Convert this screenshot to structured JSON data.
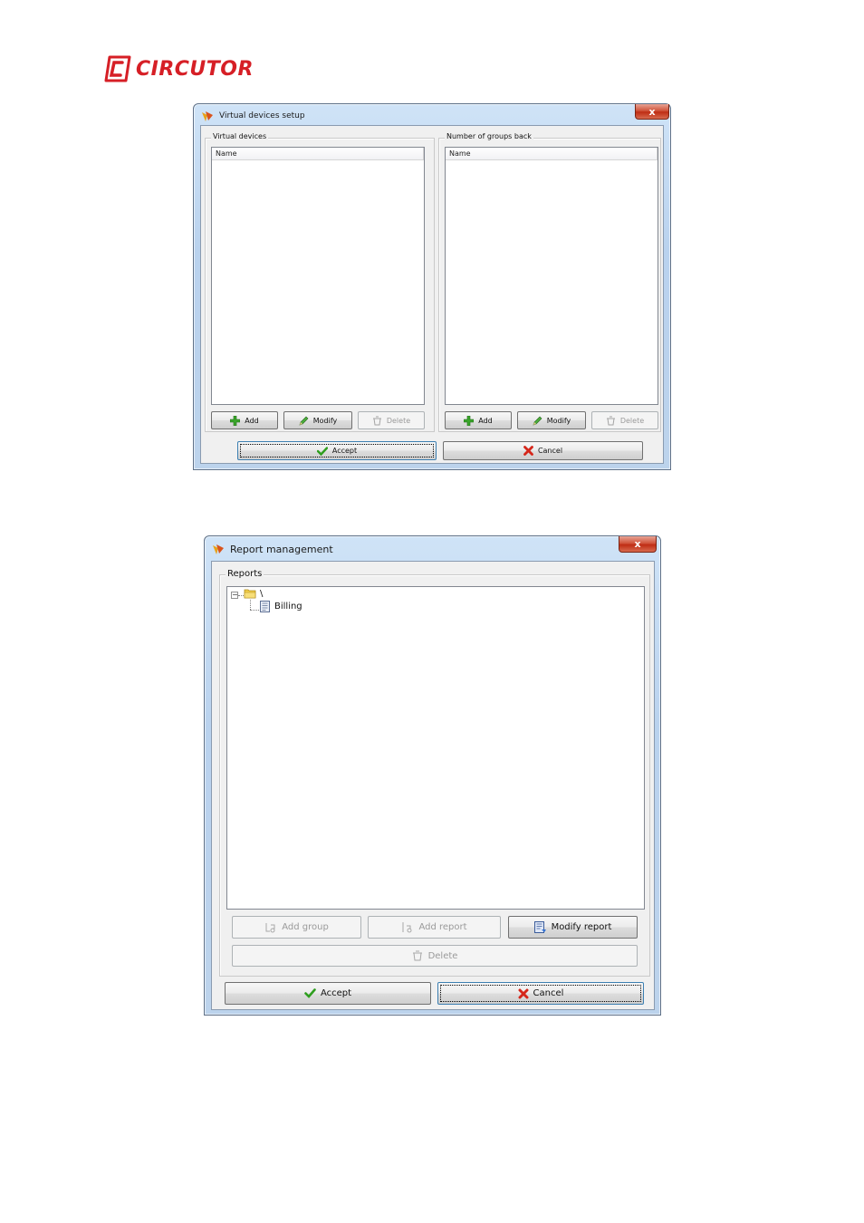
{
  "logo": {
    "text": "CIRCUTOR",
    "color": "#d61f26"
  },
  "dialog_virtual": {
    "title": "Virtual devices setup",
    "close_label": "x",
    "left_group": {
      "label": "Virtual devices",
      "column_header": "Name",
      "buttons": {
        "add": "Add",
        "modify": "Modify",
        "delete": "Delete"
      }
    },
    "right_group": {
      "label": "Number of groups back",
      "column_header": "Name",
      "buttons": {
        "add": "Add",
        "modify": "Modify",
        "delete": "Delete"
      }
    },
    "accept": "Accept",
    "cancel": "Cancel"
  },
  "dialog_report": {
    "title": "Report management",
    "close_label": "x",
    "group_label": "Reports",
    "tree": {
      "root": "\\",
      "children": [
        "Billing"
      ]
    },
    "buttons": {
      "add_group": "Add group",
      "add_report": "Add report",
      "modify_report": "Modify report",
      "delete": "Delete"
    },
    "accept": "Accept",
    "cancel": "Cancel"
  }
}
